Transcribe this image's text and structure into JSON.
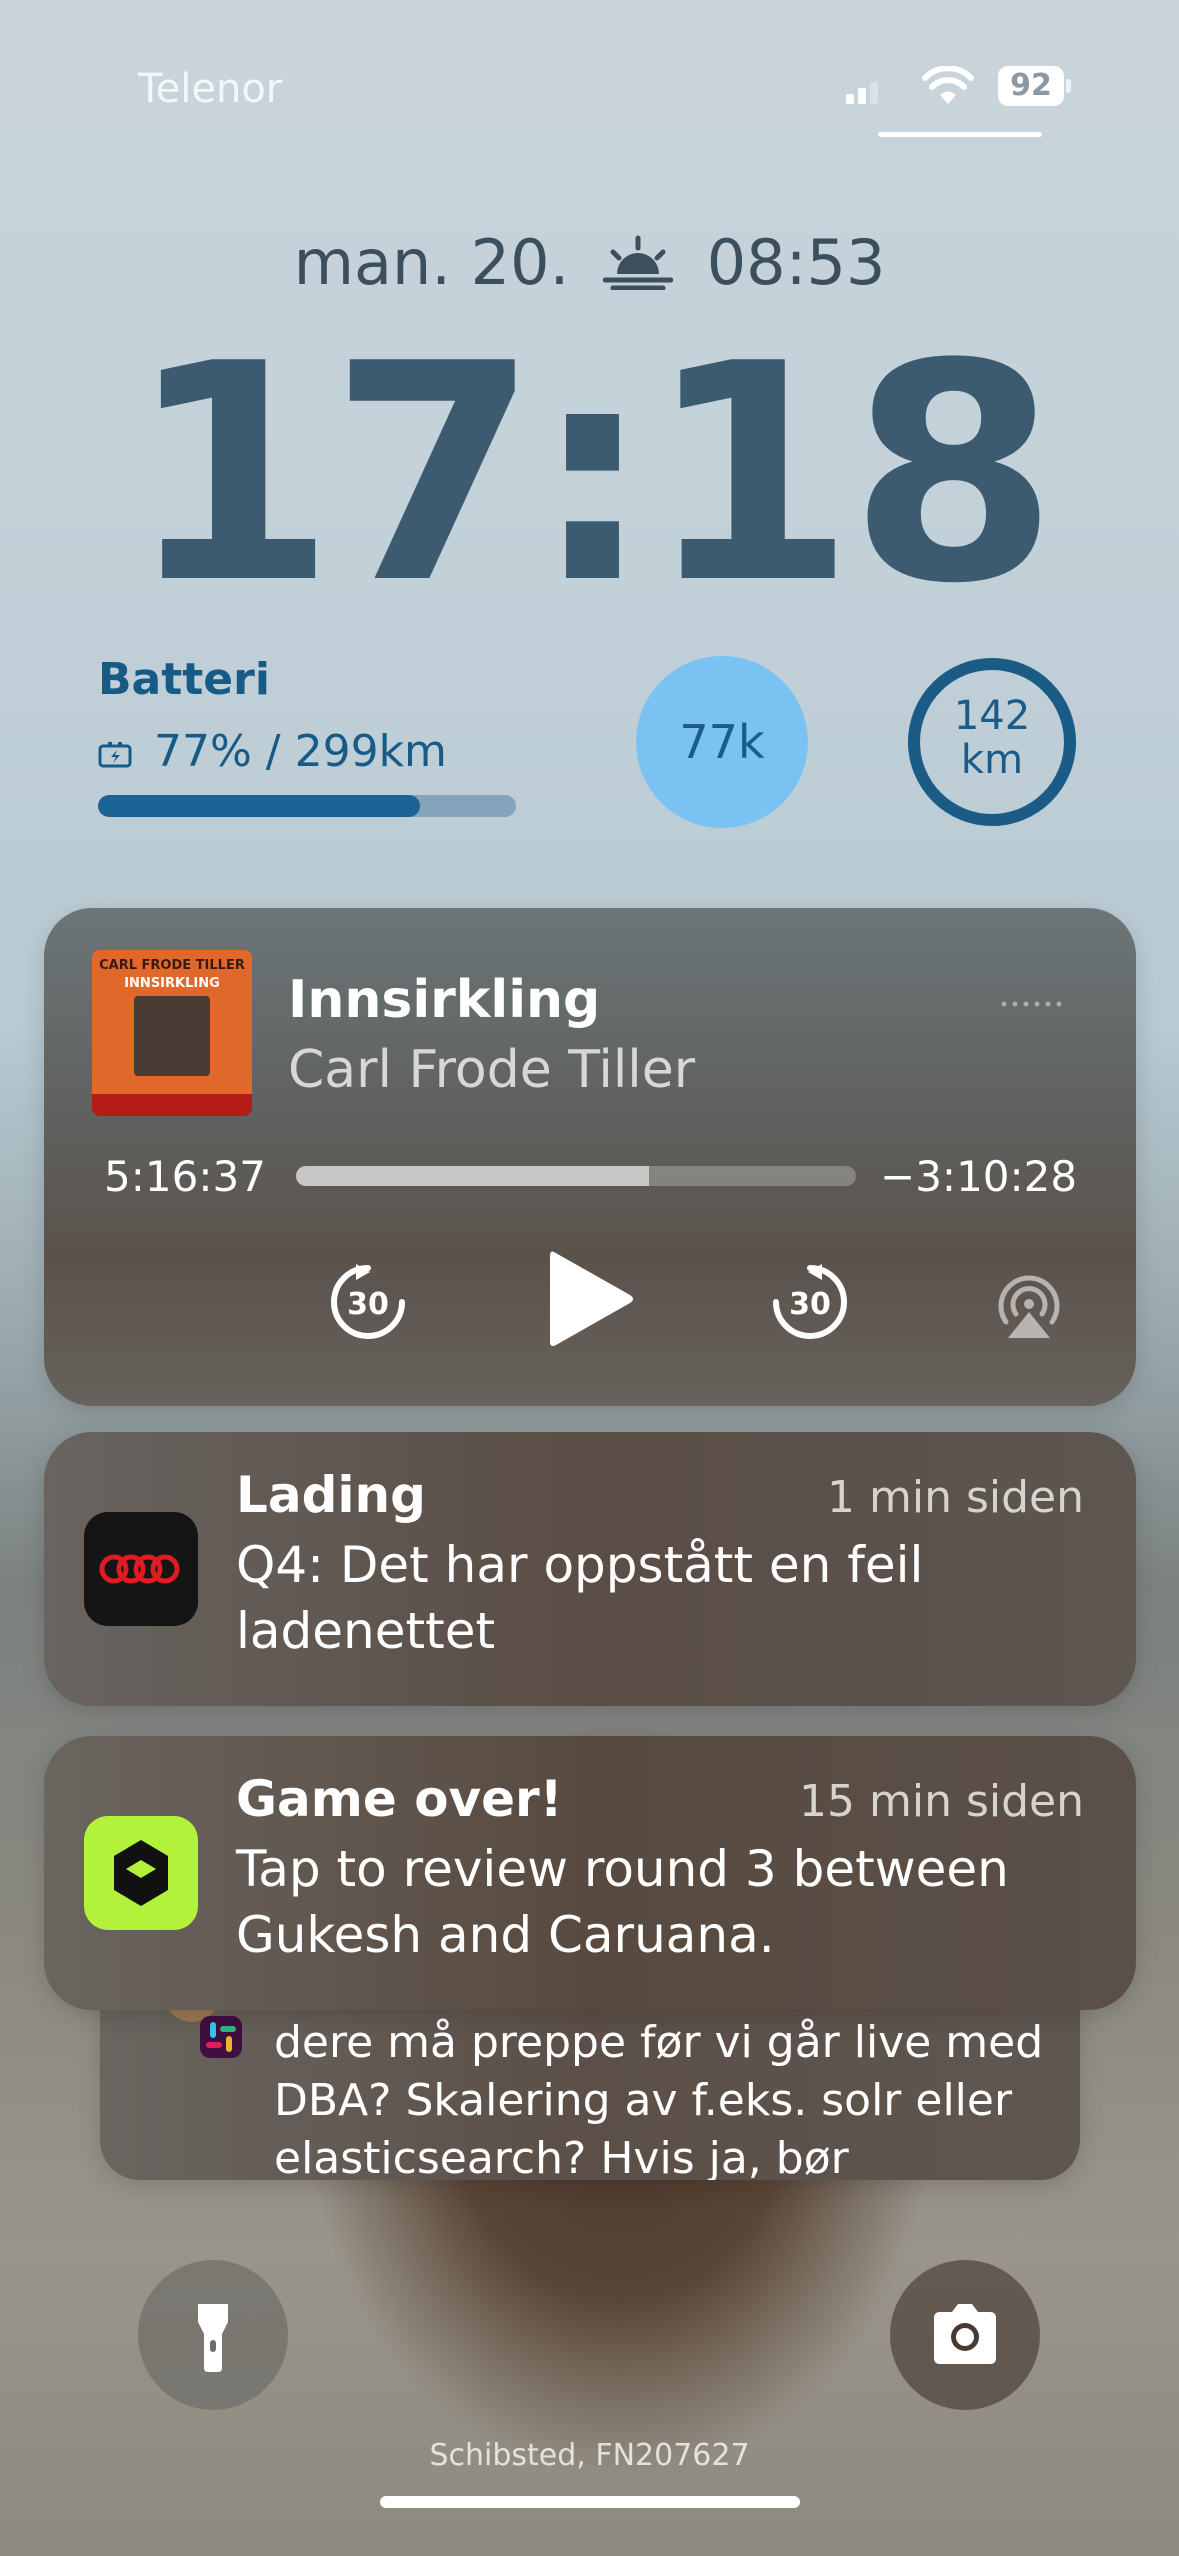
{
  "status_bar": {
    "carrier": "Telenor",
    "battery_level": "92",
    "signal_bars_active": 2,
    "signal_bars_total": 4
  },
  "lock_screen": {
    "date": "man. 20.",
    "sunrise_time": "08:53",
    "time": "17:18",
    "widgets": {
      "battery": {
        "title": "Batteri",
        "value": "77% / 299km",
        "fill_fraction": 0.77
      },
      "bubble": {
        "value": "77k"
      },
      "ring": {
        "value": "142",
        "unit": "km",
        "fill_fraction": 1.0
      }
    }
  },
  "now_playing": {
    "artwork_title_line1": "CARL FRODE TILLER",
    "artwork_title_line2": "INNSIRKLING",
    "title": "Innsirkling",
    "artist": "Carl Frode Tiller",
    "elapsed": "5:16:37",
    "remaining": "−3:10:28",
    "progress_fraction": 0.63,
    "skip_back_seconds": "30",
    "skip_forward_seconds": "30"
  },
  "notifications": [
    {
      "app_icon": "audi-icon",
      "title": "Lading",
      "time": "1 min siden",
      "body": "Q4: Det har oppstått en feil ladenettet"
    },
    {
      "app_icon": "chess-app-icon",
      "title": "Game over!",
      "time": "15 min siden",
      "body": "Tap to review round 3 between Gukesh and Caruana."
    },
    {
      "app_icon": "slack-icon",
      "body": "DBA rollout prep. Er det andre ting dere må preppe før vi går live med DBA? Skalering av f.eks. solr eller elasticsearch? Hvis ja, bør"
    }
  ],
  "footer": {
    "text": "Schibsted, FN207627"
  },
  "colors": {
    "accent": "#175a86",
    "bubble": "#79c2f2",
    "chess_green": "#b3f23b"
  }
}
